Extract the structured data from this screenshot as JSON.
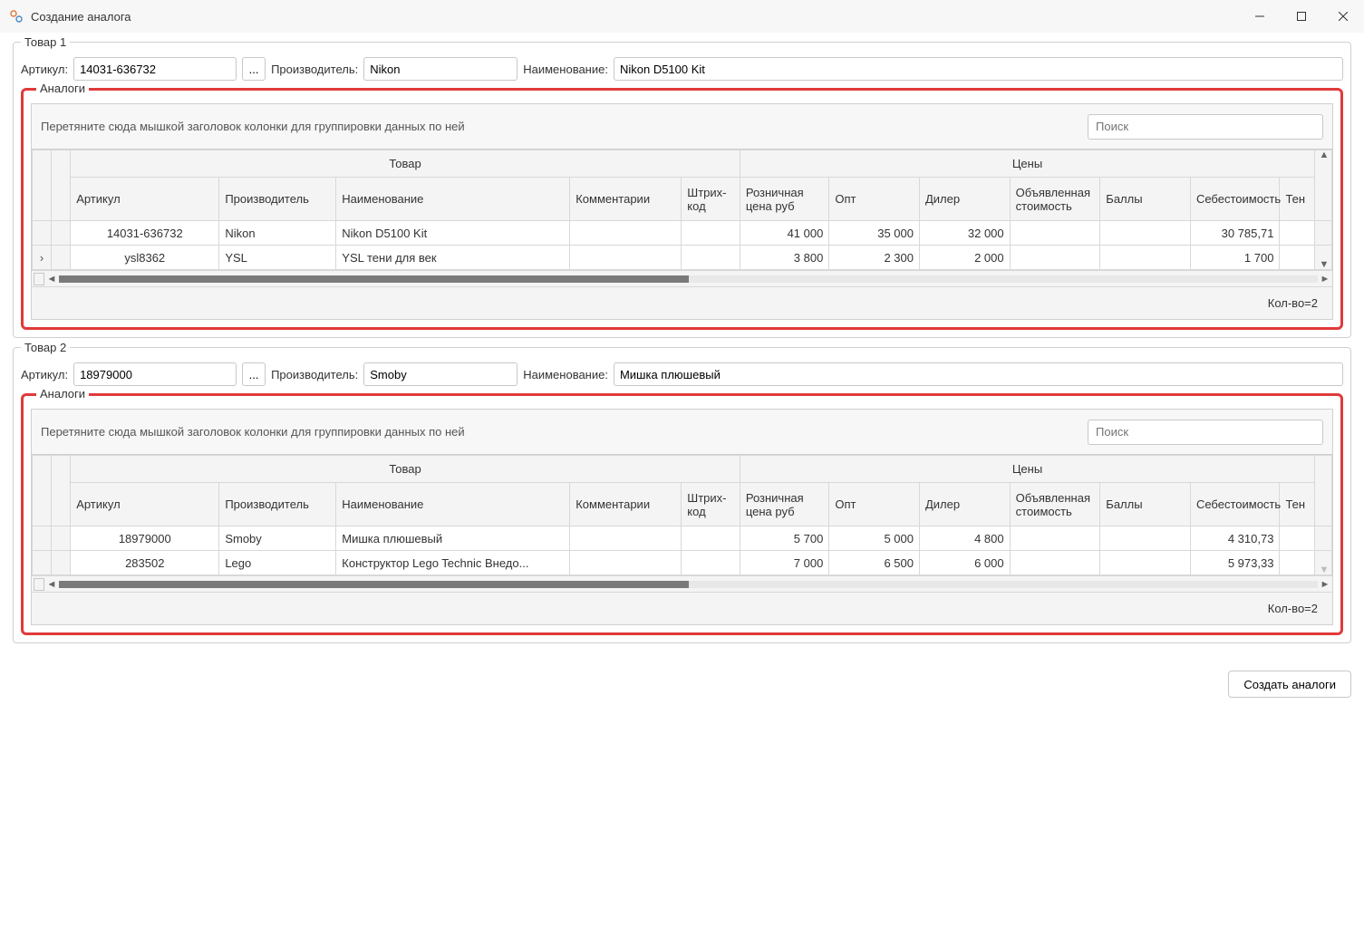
{
  "window": {
    "title": "Создание аналога"
  },
  "labels": {
    "article": "Артикул:",
    "manufacturer": "Производитель:",
    "name": "Наименование:",
    "analogs": "Аналоги",
    "grouping_hint": "Перетяните сюда мышкой заголовок колонки для группировки данных по ней",
    "search_placeholder": "Поиск",
    "ellipsis": "..."
  },
  "headers": {
    "tovar_group": "Товар",
    "prices_group": "Цены",
    "article": "Артикул",
    "manufacturer": "Производитель",
    "name": "Наименование",
    "comments": "Комментарии",
    "barcode": "Штрих-код",
    "retail": "Розничная цена руб",
    "opt": "Опт",
    "dealer": "Дилер",
    "declared": "Объявленная стоимость",
    "points": "Баллы",
    "cost": "Себестоимость",
    "tail": "Тен"
  },
  "products": [
    {
      "legend": "Товар 1",
      "article": "14031-636732",
      "manufacturer": "Nikon",
      "name": "Nikon D5100 Kit",
      "footer": "Кол-во=2",
      "rows": [
        {
          "indicator": "",
          "article": "14031-636732",
          "manufacturer": "Nikon",
          "name": "Nikon D5100 Kit",
          "comments": "",
          "barcode": "",
          "retail": "41 000",
          "opt": "35 000",
          "dealer": "32 000",
          "declared": "",
          "points": "",
          "cost": "30 785,71"
        },
        {
          "indicator": "›",
          "article": "ysl8362",
          "manufacturer": "YSL",
          "name": "YSL тени для век",
          "comments": "",
          "barcode": "",
          "retail": "3 800",
          "opt": "2 300",
          "dealer": "2 000",
          "declared": "",
          "points": "",
          "cost": "1 700"
        }
      ]
    },
    {
      "legend": "Товар 2",
      "article": "18979000",
      "manufacturer": "Smoby",
      "name": "Мишка плюшевый",
      "footer": "Кол-во=2",
      "rows": [
        {
          "indicator": "",
          "article": "18979000",
          "manufacturer": "Smoby",
          "name": "Мишка плюшевый",
          "comments": "",
          "barcode": "",
          "retail": "5 700",
          "opt": "5 000",
          "dealer": "4 800",
          "declared": "",
          "points": "",
          "cost": "4 310,73"
        },
        {
          "indicator": "",
          "article": "283502",
          "manufacturer": "Lego",
          "name": "Конструктор Lego Technic Внедо...",
          "comments": "",
          "barcode": "",
          "retail": "7 000",
          "opt": "6 500",
          "dealer": "6 000",
          "declared": "",
          "points": "",
          "cost": "5 973,33"
        }
      ]
    }
  ],
  "buttons": {
    "create": "Создать аналоги"
  }
}
